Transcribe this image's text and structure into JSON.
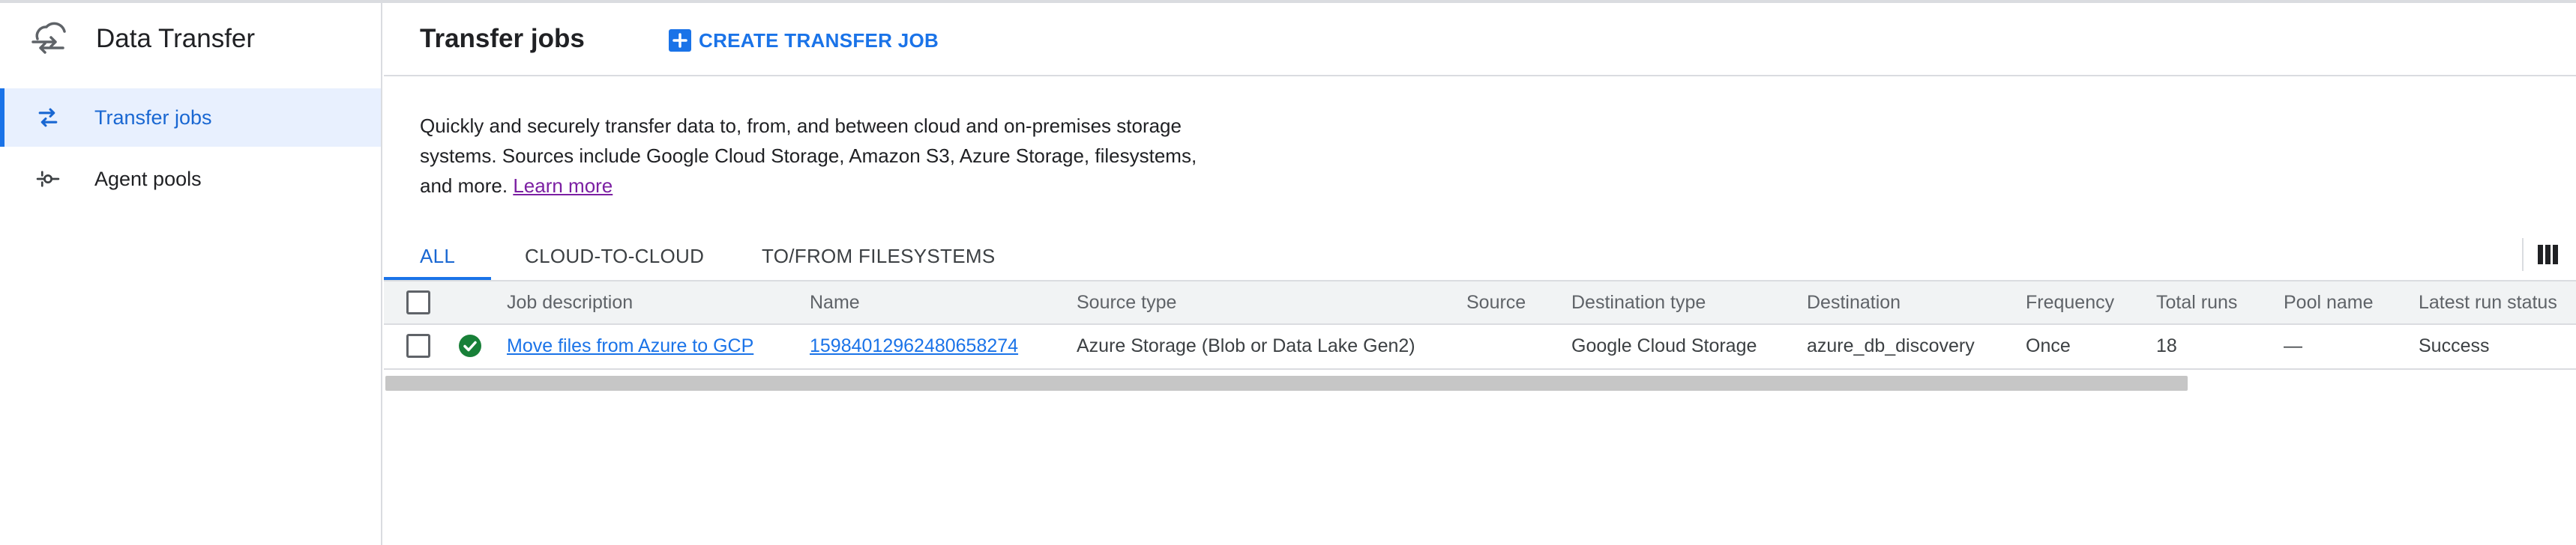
{
  "app": {
    "title": "Data Transfer",
    "logo_icon": "cloud-transfer-icon"
  },
  "sidebar": {
    "items": [
      {
        "label": "Transfer jobs",
        "icon": "swap-arrows-icon",
        "active": true
      },
      {
        "label": "Agent pools",
        "icon": "agent-node-icon",
        "active": false
      }
    ]
  },
  "header": {
    "title": "Transfer jobs",
    "create_label": "CREATE TRANSFER JOB"
  },
  "description": {
    "text": "Quickly and securely transfer data to, from, and between cloud and on-premises storage systems. Sources include Google Cloud Storage, Amazon S3, Azure Storage, filesystems, and more.",
    "link": "Learn more"
  },
  "tabs": [
    {
      "label": "ALL",
      "active": true
    },
    {
      "label": "CLOUD-TO-CLOUD",
      "active": false
    },
    {
      "label": "TO/FROM FILESYSTEMS",
      "active": false
    }
  ],
  "table": {
    "columns": [
      "Job description",
      "Name",
      "Source type",
      "Source",
      "Destination type",
      "Destination",
      "Frequency",
      "Total runs",
      "Pool name",
      "Latest run status"
    ],
    "rows": [
      {
        "status": "success",
        "job_description": "Move files from Azure to GCP",
        "name": "15984012962480658274",
        "source_type": "Azure Storage (Blob or Data Lake Gen2)",
        "source": "",
        "destination_type": "Google Cloud Storage",
        "destination": "azure_db_discovery",
        "frequency": "Once",
        "total_runs": "18",
        "pool_name": "—",
        "latest_run_status": "Success"
      }
    ]
  },
  "colors": {
    "accent": "#1a73e8",
    "active_bg": "#e8f0fe",
    "success": "#188038",
    "link_visited": "#7b1fa2"
  }
}
